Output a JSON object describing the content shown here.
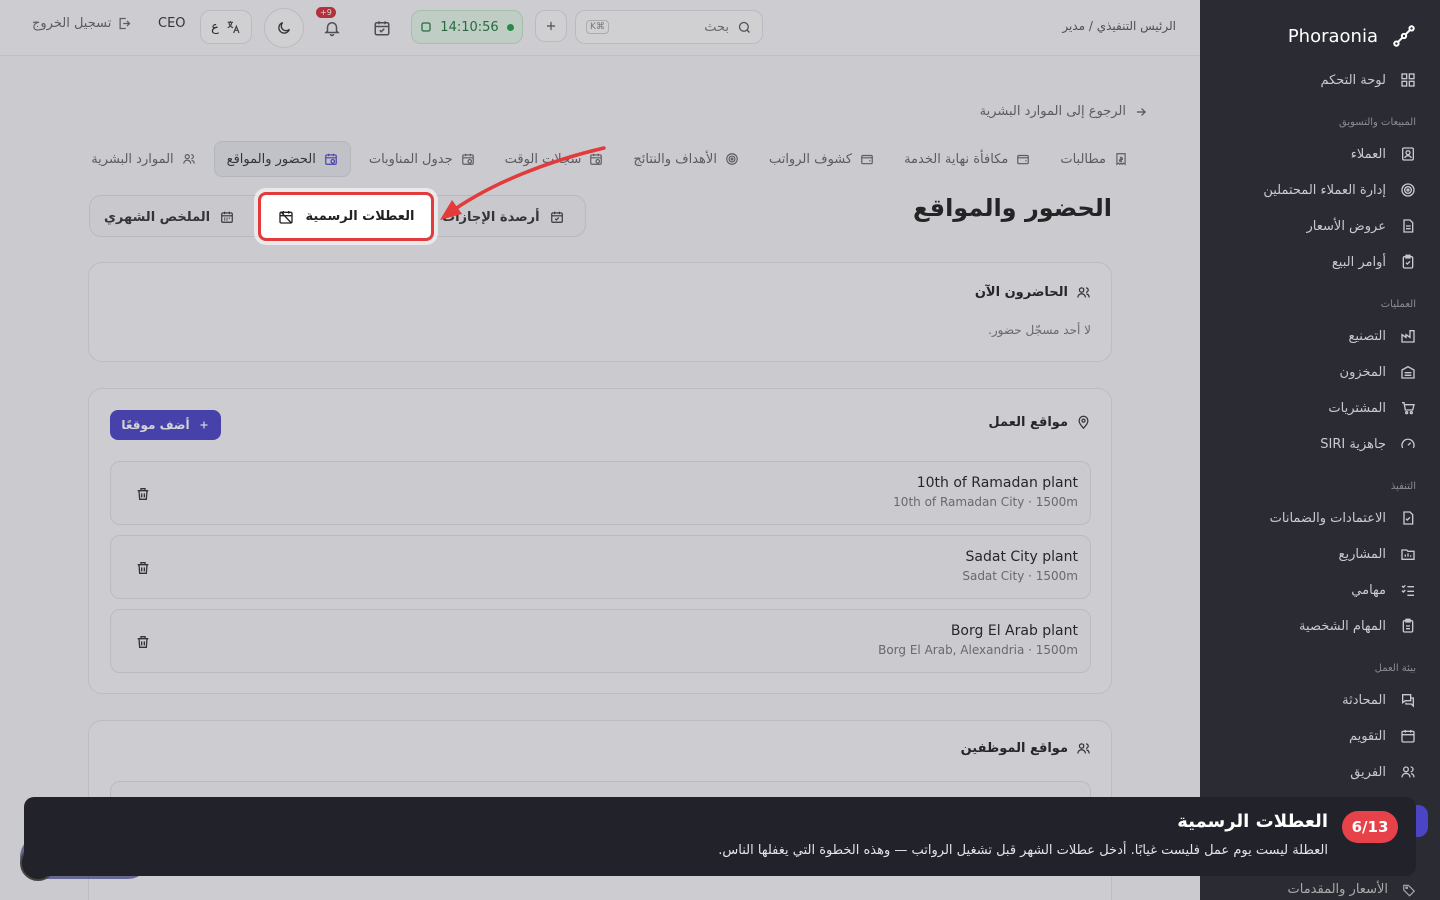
{
  "brand": {
    "name": "Phoraonia"
  },
  "sidebar": {
    "items": [
      {
        "label": "لوحة التحكم",
        "icon": "dashboard-icon"
      },
      {
        "section": "المبيعات والتسويق"
      },
      {
        "label": "العملاء",
        "icon": "customers-icon"
      },
      {
        "label": "إدارة العملاء المحتملين",
        "icon": "leads-icon"
      },
      {
        "label": "عروض الأسعار",
        "icon": "quotes-icon"
      },
      {
        "label": "أوامر البيع",
        "icon": "orders-icon"
      },
      {
        "section": "العمليات"
      },
      {
        "label": "التصنيع",
        "icon": "factory-icon"
      },
      {
        "label": "المخزون",
        "icon": "inventory-icon"
      },
      {
        "label": "المشتريات",
        "icon": "cart-icon"
      },
      {
        "label": "جاهزية SIRI",
        "icon": "gauge-icon"
      },
      {
        "section": "التنفيذ"
      },
      {
        "label": "الاعتمادات والضمانات",
        "icon": "document-icon"
      },
      {
        "label": "المشاريع",
        "icon": "projects-icon"
      },
      {
        "label": "مهامي",
        "icon": "tasks-icon"
      },
      {
        "label": "المهام الشخصية",
        "icon": "clipboard-icon"
      },
      {
        "section": "بيئة العمل"
      },
      {
        "label": "المحادثة",
        "icon": "chat-icon"
      },
      {
        "label": "التقويم",
        "icon": "calendar-icon"
      },
      {
        "label": "الفريق",
        "icon": "team-icon"
      }
    ],
    "bottom_label": "الأسعار والمقدمات"
  },
  "topbar": {
    "role": "الرئيس التنفيذي / مدير",
    "search_placeholder": "بحث",
    "search_kbd": "K⌘",
    "clock": "14:10:56",
    "notif_badge": "+9",
    "lang": "ع",
    "user": "CEO",
    "logout": "تسجيل الخروج"
  },
  "back_link": "الرجوع إلى الموارد البشرية",
  "tabs": [
    {
      "label": "الموارد البشرية",
      "icon": "users-icon",
      "active": false
    },
    {
      "label": "الحضور والمواقع",
      "icon": "calendar-clock-icon",
      "active": true
    },
    {
      "label": "جدول المناوبات",
      "icon": "calendar-clock-icon",
      "active": false
    },
    {
      "label": "سجلات الوقت",
      "icon": "calendar-clock-icon",
      "active": false
    },
    {
      "label": "الأهداف والنتائج",
      "icon": "target-icon",
      "active": false
    },
    {
      "label": "كشوف الرواتب",
      "icon": "wallet-icon",
      "active": false
    },
    {
      "label": "مكافأة نهاية الخدمة",
      "icon": "wallet-icon",
      "active": false
    },
    {
      "label": "مطالبات",
      "icon": "receipt-icon",
      "active": false
    }
  ],
  "page_title": "الحضور والمواقع",
  "subtabs": {
    "balances": "أرصدة الإجازات",
    "holidays": "العطلات الرسمية",
    "monthly": "الملخص الشهري"
  },
  "present_now": {
    "title": "الحاضرون الآن",
    "empty": "لا أحد مسجّل حضور."
  },
  "work_locations": {
    "title": "مواقع العمل",
    "add_label": "أضف موقعًا",
    "items": [
      {
        "name": "10th of Ramadan plant",
        "sub": "10th of Ramadan City · 1500m"
      },
      {
        "name": "Sadat City plant",
        "sub": "Sadat City · 1500m"
      },
      {
        "name": "Borg El Arab plant",
        "sub": "Borg El Arab, Alexandria · 1500m"
      }
    ]
  },
  "employee_locations": {
    "title": "مواقع الموظفين"
  },
  "tour": {
    "counter": "6/13",
    "title": "العطلات الرسمية",
    "description": "العطلة ليست يوم عمل فليست غيابًا. أدخل عطلات الشهر قبل تشغيل الرواتب — وهذه الخطوة التي يغفلها الناس."
  },
  "colors": {
    "sidebar_bg": "#2b2c33",
    "accent": "#4b45c6",
    "highlight": "#e33b3b",
    "tour_badge": "#e7424a",
    "clock_green": "#22a04b"
  }
}
